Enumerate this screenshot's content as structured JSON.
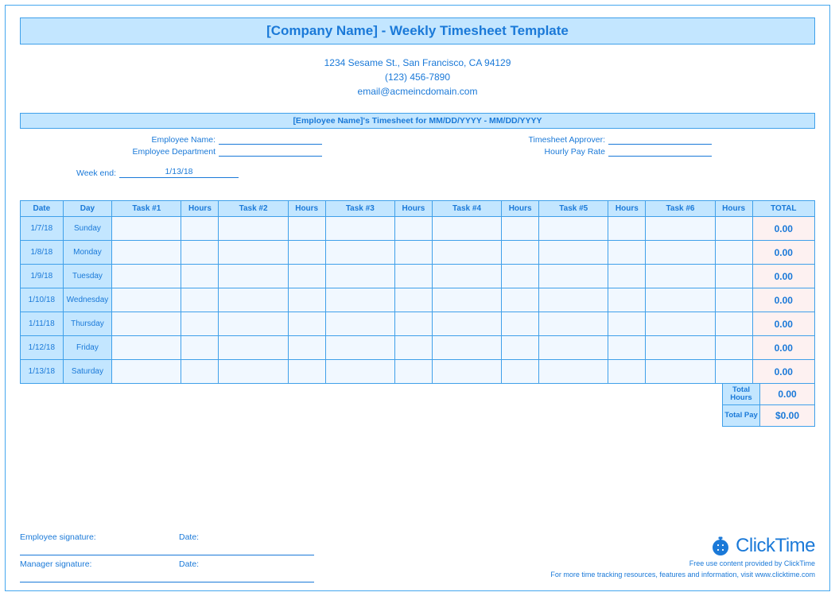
{
  "title": "[Company Name] - Weekly Timesheet Template",
  "company": {
    "address": "1234 Sesame St.,  San Francisco, CA 94129",
    "phone": "(123) 456-7890",
    "email": "email@acmeincdomain.com"
  },
  "employee_bar": "[Employee Name]'s Timesheet for MM/DD/YYYY - MM/DD/YYYY",
  "fields": {
    "employee_name_label": "Employee Name:",
    "employee_dept_label": "Employee Department",
    "approver_label": "Timesheet Approver:",
    "rate_label": "Hourly Pay Rate",
    "week_end_label": "Week end:",
    "week_end_value": "1/13/18"
  },
  "columns": {
    "date": "Date",
    "day": "Day",
    "task1": "Task #1",
    "task2": "Task #2",
    "task3": "Task #3",
    "task4": "Task #4",
    "task5": "Task #5",
    "task6": "Task #6",
    "hours": "Hours",
    "total": "TOTAL"
  },
  "rows": [
    {
      "date": "1/7/18",
      "day": "Sunday",
      "total": "0.00"
    },
    {
      "date": "1/8/18",
      "day": "Monday",
      "total": "0.00"
    },
    {
      "date": "1/9/18",
      "day": "Tuesday",
      "total": "0.00"
    },
    {
      "date": "1/10/18",
      "day": "Wednesday",
      "total": "0.00"
    },
    {
      "date": "1/11/18",
      "day": "Thursday",
      "total": "0.00"
    },
    {
      "date": "1/12/18",
      "day": "Friday",
      "total": "0.00"
    },
    {
      "date": "1/13/18",
      "day": "Saturday",
      "total": "0.00"
    }
  ],
  "summary": {
    "total_hours_label": "Total Hours",
    "total_hours_value": "0.00",
    "total_pay_label": "Total Pay",
    "total_pay_value": "$0.00"
  },
  "signatures": {
    "employee": "Employee signature:",
    "manager": "Manager signature:",
    "date": "Date:"
  },
  "footer": {
    "brand": "ClickTime",
    "line1": "Free use content provided by ClickTime",
    "line2": "For more time tracking resources, features and information, visit www.clicktime.com"
  }
}
